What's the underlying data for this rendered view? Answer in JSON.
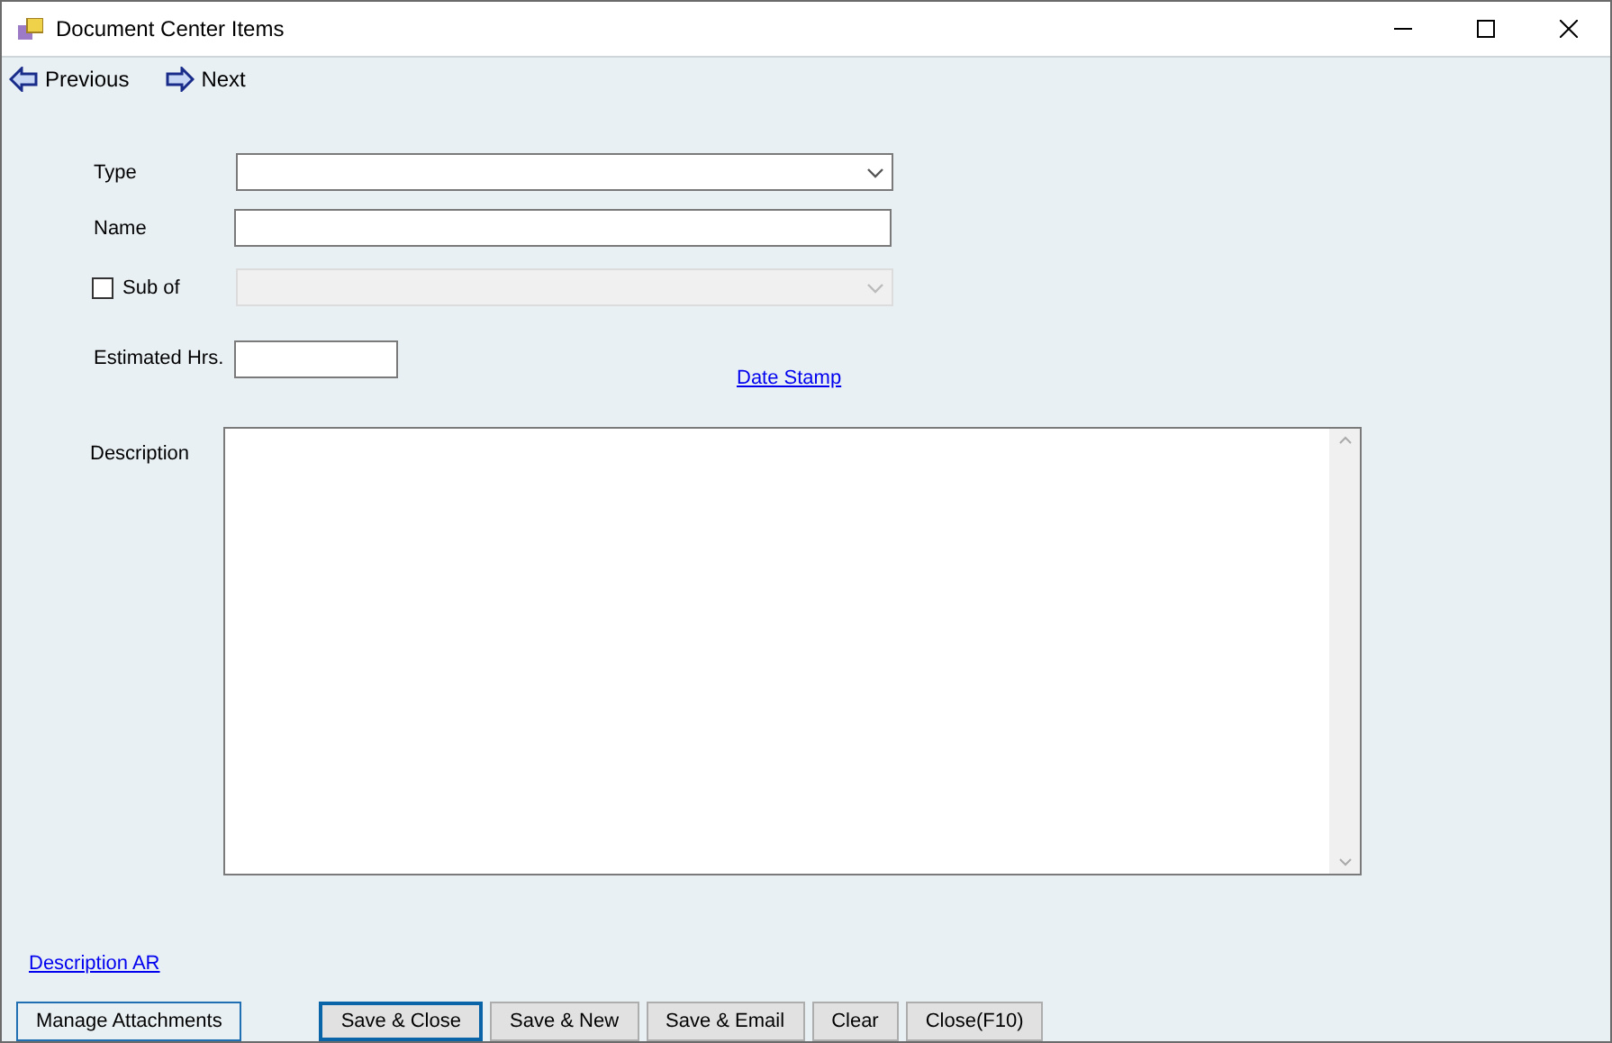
{
  "window": {
    "title": "Document Center Items"
  },
  "nav": [
    {
      "label": "Previous",
      "kind": "back"
    },
    {
      "label": "Next",
      "kind": "forward"
    }
  ],
  "form": {
    "type": {
      "label": "Type"
    },
    "name": {
      "label": "Name"
    },
    "sub_of": {
      "label": "Sub of",
      "checked": false,
      "disabled": true
    },
    "estimated_hrs": {
      "label": "Estimated Hrs."
    },
    "date_stamp": "Date Stamp",
    "description": {
      "label": "Description"
    },
    "description_ar": "Description AR"
  },
  "buttons": [
    {
      "label": "Manage Attachments",
      "focused": true
    },
    {
      "label": "Save & Close",
      "focused": true
    },
    {
      "label": "Save & New",
      "focused": false
    },
    {
      "label": "Save & Email",
      "focused": false
    },
    {
      "label": "Clear",
      "focused": false
    },
    {
      "label": "Close(F10)",
      "focused": false
    }
  ]
}
